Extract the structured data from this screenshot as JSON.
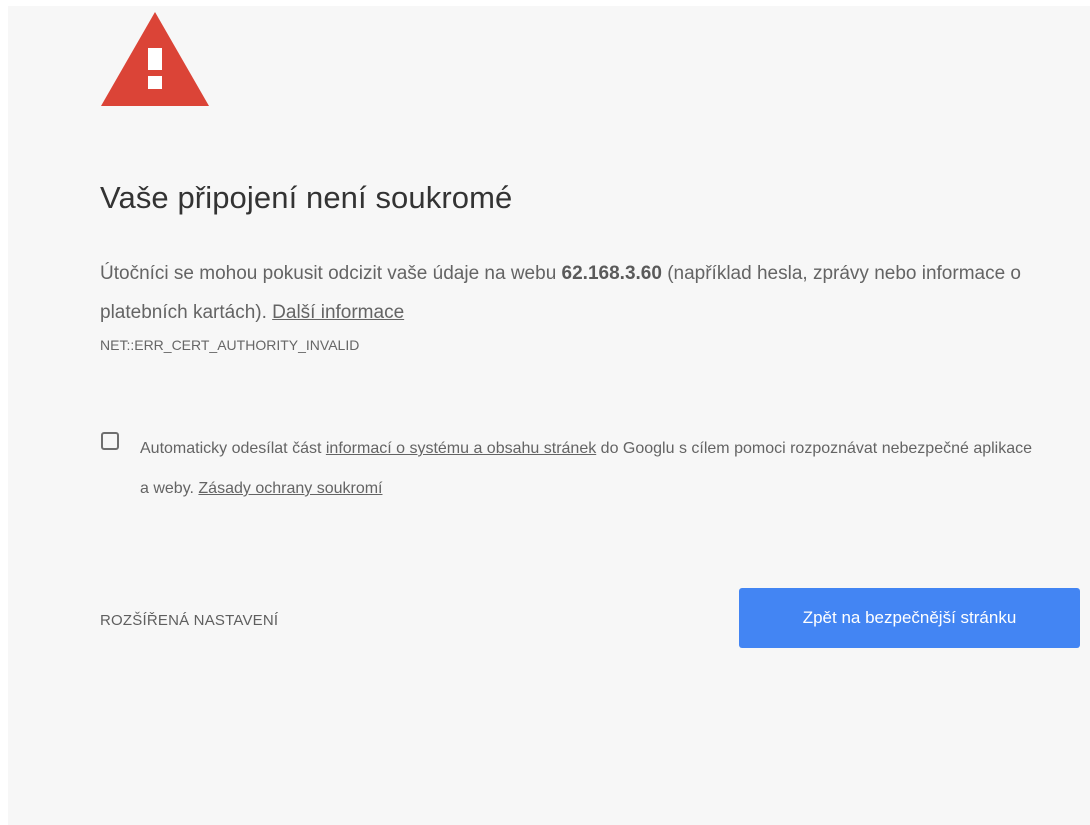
{
  "colors": {
    "background": "#f7f7f7",
    "warning_red": "#db4437",
    "primary_blue": "#4385f3",
    "text": "#646464",
    "title_text": "#333333"
  },
  "icon": {
    "name": "warning-triangle-icon",
    "glyph": "!"
  },
  "title": "Vaše připojení není soukromé",
  "description": {
    "text_before": "Útočníci se mohou pokusit odcizit vaše údaje na webu ",
    "host": "62.168.3.60",
    "text_after": " (například hesla, zprávy nebo informace o platebních kartách). ",
    "learn_more_link": "Další informace"
  },
  "error_code": "NET::ERR_CERT_AUTHORITY_INVALID",
  "optin": {
    "checked": false,
    "text_before": "Automaticky odesílat část ",
    "link_1": "informací o systému a obsahu stránek",
    "text_middle": " do Googlu s cílem pomoci rozpoznávat nebezpečné aplikace a weby. ",
    "link_2": "Zásady ochrany soukromí"
  },
  "buttons": {
    "advanced": "ROZŠÍŘENÁ NASTAVENÍ",
    "back_to_safety": "Zpět na bezpečnější stránku"
  }
}
